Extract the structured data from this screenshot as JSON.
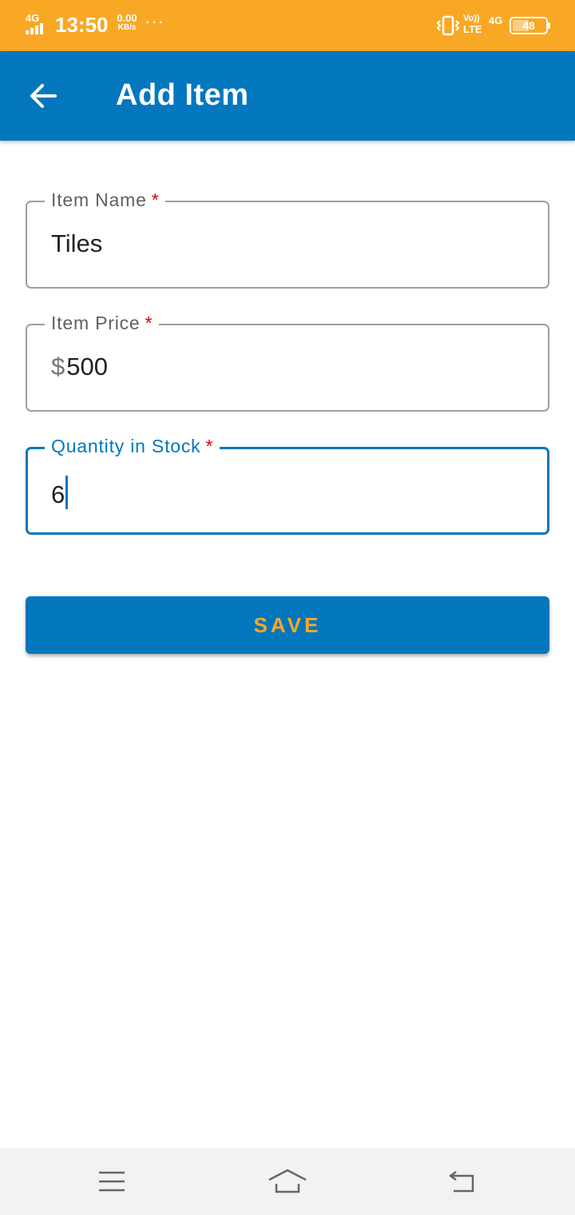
{
  "status_bar": {
    "network_type": "4G",
    "time": "13:50",
    "data_speed_value": "0.00",
    "data_speed_unit": "KB/s",
    "more_indicator": "···",
    "volte_top": "Vo))",
    "volte_bottom": "LTE",
    "network_type_2": "4G",
    "battery_level": "48"
  },
  "app_bar": {
    "title": "Add Item",
    "back_icon": "arrow-back-icon"
  },
  "form": {
    "item_name": {
      "label": "Item Name",
      "required_mark": "*",
      "value": "Tiles"
    },
    "item_price": {
      "label": "Item Price",
      "required_mark": "*",
      "prefix": "$",
      "value": "500"
    },
    "quantity": {
      "label": "Quantity in Stock",
      "required_mark": "*",
      "value": "6"
    },
    "save_label": "SAVE"
  },
  "nav_bar": {
    "menu_icon": "menu-icon",
    "home_icon": "home-icon",
    "back_icon": "back-icon"
  },
  "colors": {
    "status_bar": "#F9A825",
    "primary": "#0277BD",
    "accent": "#F9A825",
    "required": "#D50000"
  }
}
